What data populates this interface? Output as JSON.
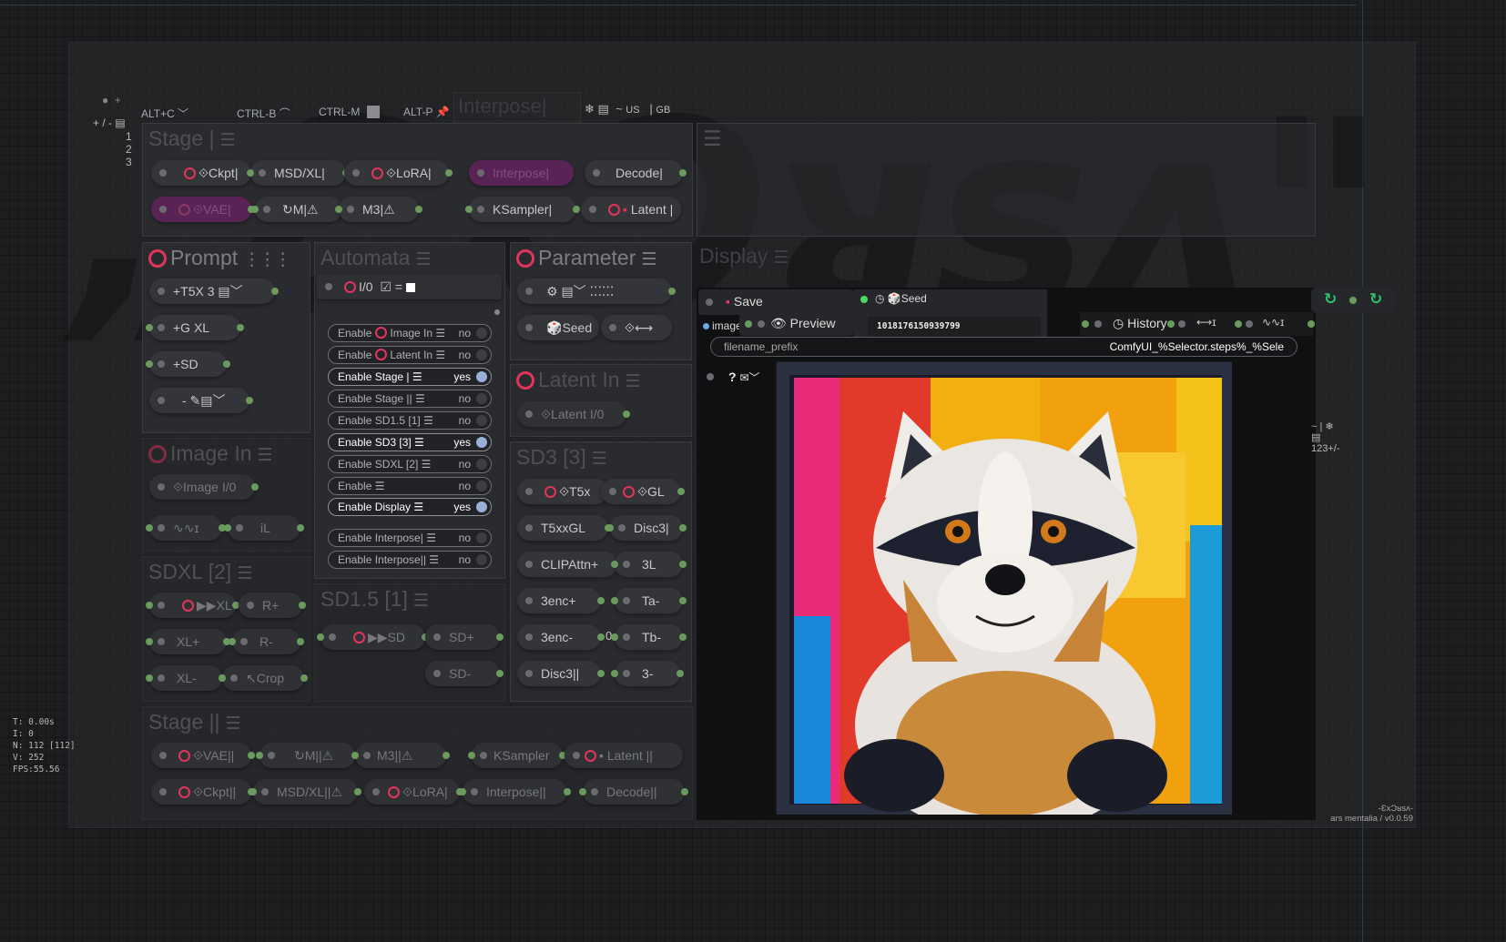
{
  "toolbar": {
    "plus_minus": "+ / -",
    "rows": [
      "1",
      "2",
      "3"
    ],
    "shortcuts": [
      {
        "key": "ALT+C",
        "icon": "chevron-down-icon"
      },
      {
        "key": "CTRL-B",
        "icon": "wave-icon"
      },
      {
        "key": "CTRL-M",
        "icon": "square-icon"
      },
      {
        "key": "ALT-P",
        "icon": "pin-icon"
      }
    ],
    "interpose_ghost": "Interpose|",
    "lang_tilde": "~",
    "lang_us": "US",
    "lang_gb": "GB"
  },
  "stage1": {
    "title": "Stage |",
    "nodes": [
      "⟐Ckpt|",
      "MSD/XL|",
      "⟐LoRA|",
      "Interpose|",
      "Decode|",
      "⟐VAE|",
      "↻M|⚠",
      "M3|⚠",
      "KSampler|",
      "Latent |"
    ]
  },
  "prompt": {
    "title": "Prompt",
    "nodes": [
      "+T5X 3",
      "+G XL",
      "+SD",
      "-"
    ]
  },
  "automata": {
    "title": "Automata",
    "io_label": "I/0",
    "io_extra": "☑ =",
    "toggles": [
      {
        "label": "Enable",
        "sub": "Image In",
        "value": "no",
        "on": false
      },
      {
        "label": "Enable",
        "sub": "Latent In",
        "value": "no",
        "on": false
      },
      {
        "label": "Enable Stage |",
        "sub": "",
        "value": "yes",
        "on": true
      },
      {
        "label": "Enable Stage ||",
        "sub": "",
        "value": "no",
        "on": false
      },
      {
        "label": "Enable SD1.5 [1]",
        "sub": "",
        "value": "no",
        "on": false
      },
      {
        "label": "Enable SD3 [3]",
        "sub": "",
        "value": "yes",
        "on": true
      },
      {
        "label": "Enable SDXL [2]",
        "sub": "",
        "value": "no",
        "on": false
      },
      {
        "label": "Enable",
        "sub": "",
        "value": "no",
        "on": false
      },
      {
        "label": "Enable Display",
        "sub": "",
        "value": "yes",
        "on": true
      },
      {
        "label": "Enable Interpose|",
        "sub": "",
        "value": "no",
        "on": false
      },
      {
        "label": "Enable Interpose||",
        "sub": "",
        "value": "no",
        "on": false
      }
    ]
  },
  "parameter": {
    "title": "Parameter",
    "seed_label": "Seed",
    "arrows": "⟐⟷"
  },
  "latent_in": {
    "title": "Latent In",
    "node": "⟐Latent I/0"
  },
  "image_in": {
    "title": "Image In",
    "node": "⟐Image I/0",
    "node2": "iL"
  },
  "sdxl": {
    "title": "SDXL [2]",
    "nodes": [
      "▶▶XL",
      "R+",
      "XL+",
      "R-",
      "XL-",
      "↖Crop"
    ]
  },
  "sd15": {
    "title": "SD1.5 [1]",
    "nodes": [
      "▶▶SD",
      "SD+",
      "SD-"
    ]
  },
  "sd3": {
    "title": "SD3 [3]",
    "nodes": [
      "⟐T5x",
      "⟐GL",
      "T5xxGL",
      "Disc3|",
      "CLIPAttn+",
      "3L",
      "3enc+",
      "Ta-",
      "3enc-",
      "0",
      "Tb-",
      "Disc3||",
      "3-"
    ]
  },
  "stage2": {
    "title": "Stage ||",
    "nodes": [
      "⟐VAE||",
      "↻M||⚠",
      "M3||⚠",
      "KSampler",
      "Latent ||",
      "⟐Ckpt||",
      "MSD/XL||⚠",
      "⟐LoRA|",
      "Interpose||",
      "Decode||"
    ]
  },
  "display": {
    "title": "Display",
    "save_label": "Save",
    "seed_label": "Seed",
    "seed_value": "1018176150939799",
    "image_label": "image",
    "preview_label": "Preview",
    "history_label": "History",
    "filename_label": "filename_prefix",
    "filename_value": "ComfyUI_%Selector.steps%_%Sele",
    "help_label": "?"
  },
  "side_info": {
    "top": "~ |",
    "bottom": "123+/-"
  },
  "stats": [
    "T: 0.00s",
    "I: 0",
    "N: 112 [112]",
    "V: 252",
    "FPS:55.56"
  ],
  "footer": {
    "logo": "-ƐxƆᴚsʌ-",
    "version": "ars mentalia / v0.0.59"
  },
  "colors": {
    "accent": "#e2345d",
    "port": "#6a9a5e",
    "toggle_on": "#9ab0d8",
    "node_purple": "#5a2355",
    "history_green": "#2fc26a"
  }
}
